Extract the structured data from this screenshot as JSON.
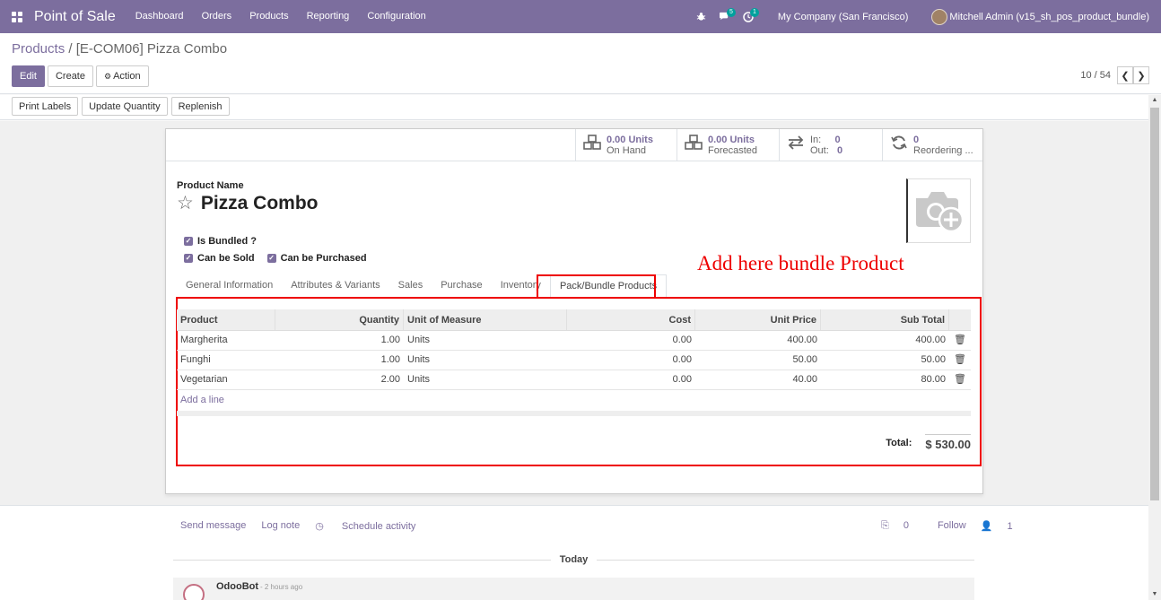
{
  "navbar": {
    "brand": "Point of Sale",
    "menu": [
      "Dashboard",
      "Orders",
      "Products",
      "Reporting",
      "Configuration"
    ],
    "chat_count": "5",
    "activity_count": "1",
    "company": "My Company (San Francisco)",
    "user": "Mitchell Admin (v15_sh_pos_product_bundle)"
  },
  "breadcrumb": {
    "parent": "Products",
    "separator": "/",
    "current": "[E-COM06] Pizza Combo"
  },
  "buttons": {
    "edit": "Edit",
    "create": "Create",
    "action": "Action"
  },
  "pager": {
    "text": "10 / 54",
    "prev": "❮",
    "next": "❯"
  },
  "statusbar": {
    "print_labels": "Print Labels",
    "update_quantity": "Update Quantity",
    "replenish": "Replenish"
  },
  "smart_buttons": {
    "on_hand_value": "0.00 Units",
    "on_hand_label": "On Hand",
    "forecasted_value": "0.00 Units",
    "forecasted_label": "Forecasted",
    "in_label": "In:",
    "in_value": "0",
    "out_label": "Out:",
    "out_value": "0",
    "reordering_value": "0",
    "reordering_label": "Reordering ..."
  },
  "product": {
    "name_label": "Product Name",
    "name": "Pizza Combo",
    "is_bundled": "Is Bundled ?",
    "can_be_sold": "Can be Sold",
    "can_be_purchased": "Can be Purchased"
  },
  "annotation": "Add here bundle Product",
  "tabs": [
    "General Information",
    "Attributes & Variants",
    "Sales",
    "Purchase",
    "Inventory",
    "Pack/Bundle Products"
  ],
  "table": {
    "headers": [
      "Product",
      "Quantity",
      "Unit of Measure",
      "Cost",
      "Unit Price",
      "Sub Total"
    ],
    "rows": [
      {
        "product": "Margherita",
        "quantity": "1.00",
        "uom": "Units",
        "cost": "0.00",
        "unit_price": "400.00",
        "subtotal": "400.00"
      },
      {
        "product": "Funghi",
        "quantity": "1.00",
        "uom": "Units",
        "cost": "0.00",
        "unit_price": "50.00",
        "subtotal": "50.00"
      },
      {
        "product": "Vegetarian",
        "quantity": "2.00",
        "uom": "Units",
        "cost": "0.00",
        "unit_price": "40.00",
        "subtotal": "80.00"
      }
    ],
    "add_line": "Add a line",
    "total_label": "Total:",
    "total_value": "$ 530.00"
  },
  "chatter": {
    "send_message": "Send message",
    "log_note": "Log note",
    "schedule_activity": "Schedule activity",
    "attachments": "0",
    "follow": "Follow",
    "followers": "1",
    "today": "Today",
    "author": "OdooBot",
    "time": "- 2 hours ago"
  }
}
